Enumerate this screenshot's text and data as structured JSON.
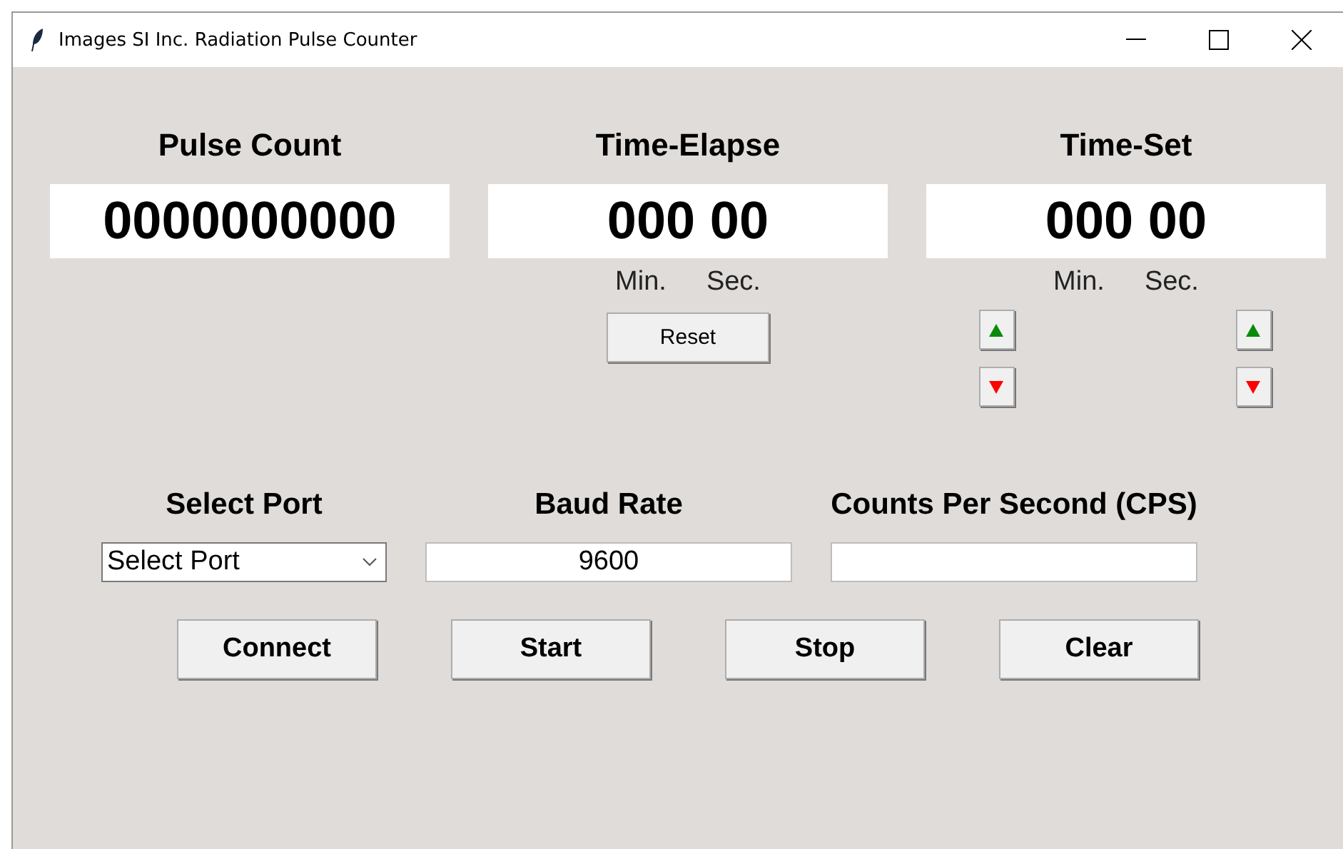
{
  "window": {
    "title": "Images SI Inc. Radiation Pulse Counter"
  },
  "displays": [
    {
      "label": "Pulse Count",
      "value": "0000000000"
    },
    {
      "label": "Time-Elapse",
      "value": "000 00",
      "units": [
        "Min.",
        "Sec."
      ],
      "button": "Reset"
    },
    {
      "label": "Time-Set",
      "value": "000 00",
      "units": [
        "Min.",
        "Sec."
      ],
      "steppers": true
    }
  ],
  "settings": [
    {
      "kind": "combo",
      "label": "Select Port",
      "value": "Select Port"
    },
    {
      "kind": "field",
      "label": "Baud Rate",
      "value": "9600"
    },
    {
      "kind": "field",
      "label": "Counts Per Second (CPS)"
    }
  ],
  "buttons": [
    "Connect",
    "Start",
    "Stop",
    "Clear"
  ]
}
